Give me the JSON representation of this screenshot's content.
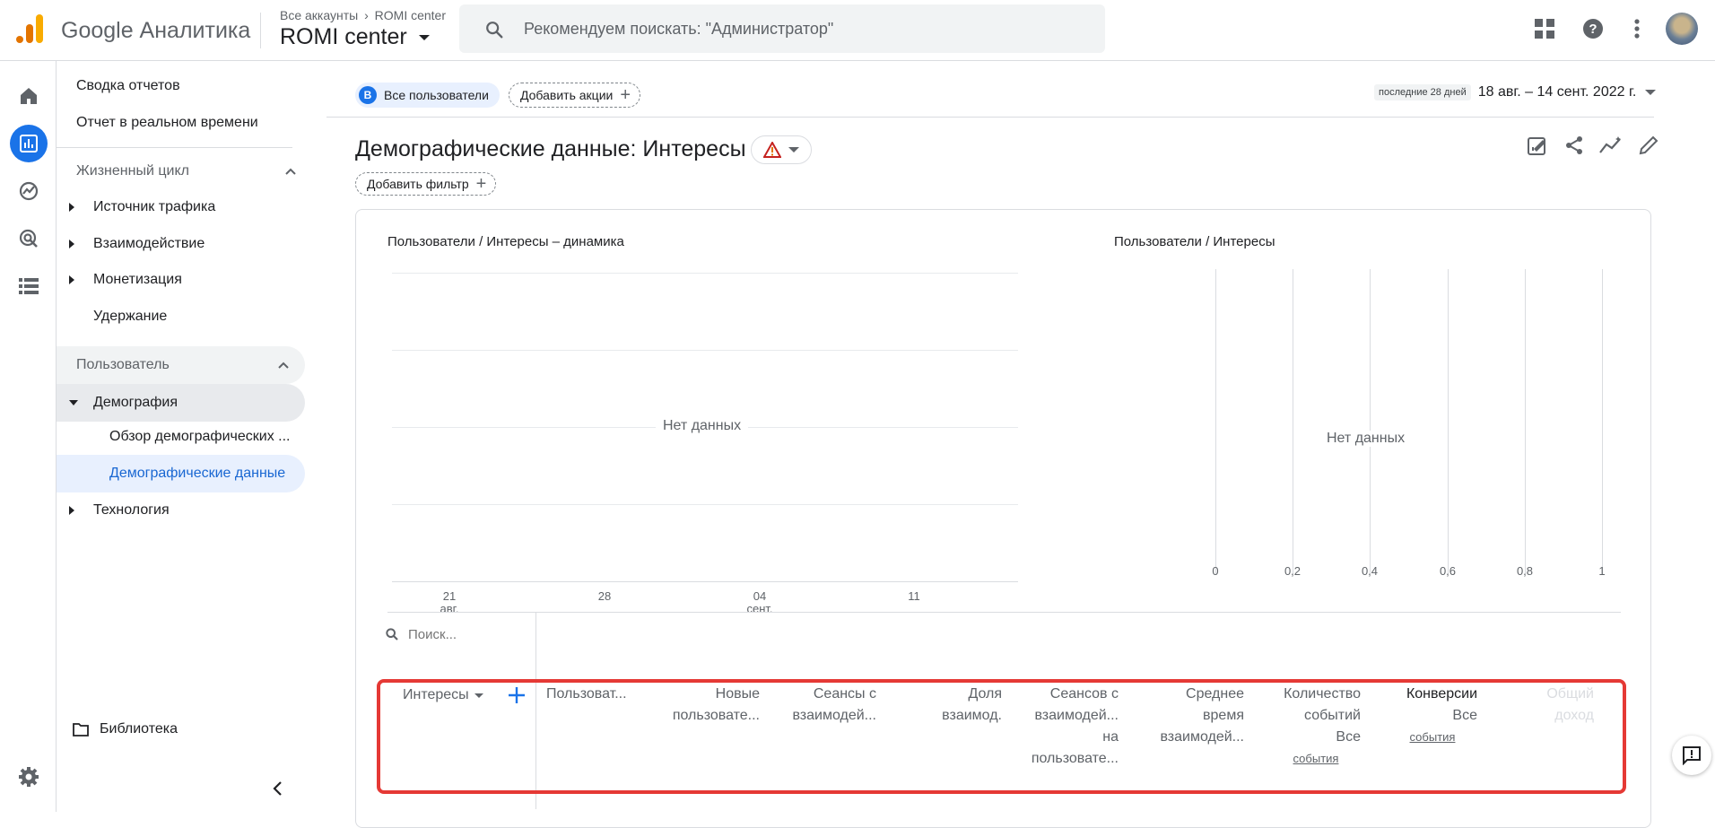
{
  "header": {
    "brand": "Google Аналитика",
    "breadcrumb_root": "Все аккаунты",
    "breadcrumb_leaf": "ROMI center",
    "account_name": "ROMI center",
    "search_placeholder": "Рекомендуем поискать: \"Администратор\""
  },
  "nav": {
    "report_summary": "Сводка отчетов",
    "realtime": "Отчет в реальном времени",
    "lifecycle_section": "Жизненный цикл",
    "lifecycle_items": [
      "Источник трафика",
      "Взаимодействие",
      "Монетизация",
      "Удержание"
    ],
    "user_section": "Пользователь",
    "demography": "Демография",
    "demo_overview": "Обзор демографических ...",
    "demo_details": "Демографические данные",
    "technology": "Технология",
    "library": "Библиотека"
  },
  "toolbar": {
    "segment_badge": "В",
    "segment_label": "Все пользователи",
    "add_comparison": "Добавить акции",
    "date_prefix": "последние 28 дней",
    "date_range": "18 авг. – 14 сент. 2022 г."
  },
  "page": {
    "title": "Демографические данные: Интересы",
    "add_filter": "Добавить фильтр"
  },
  "line_chart": {
    "title": "Пользователи / Интересы – динамика",
    "no_data": "Нет данных",
    "x_ticks": [
      {
        "day": "21",
        "month": "авг."
      },
      {
        "day": "28",
        "month": ""
      },
      {
        "day": "04",
        "month": "сент."
      },
      {
        "day": "11",
        "month": ""
      }
    ]
  },
  "bar_chart": {
    "title": "Пользователи / Интересы",
    "no_data": "Нет данных",
    "x_ticks": [
      "0",
      "0,2",
      "0,4",
      "0,6",
      "0,8",
      "1"
    ]
  },
  "table": {
    "search_placeholder": "Поиск...",
    "dimension": "Интересы",
    "columns": [
      {
        "lines": [
          "Пользоват..."
        ],
        "sub": ""
      },
      {
        "lines": [
          "Новые",
          "пользовате..."
        ],
        "sub": ""
      },
      {
        "lines": [
          "Сеансы с",
          "взаимодей..."
        ],
        "sub": ""
      },
      {
        "lines": [
          "Доля",
          "взаимод."
        ],
        "sub": ""
      },
      {
        "lines": [
          "Сеансов с",
          "взаимодей...",
          "на",
          "пользовате..."
        ],
        "sub": ""
      },
      {
        "lines": [
          "Среднее",
          "время",
          "взаимодей..."
        ],
        "sub": ""
      },
      {
        "lines": [
          "Количество",
          "событий",
          "Все"
        ],
        "sub": "события"
      },
      {
        "lines": [
          "Конверсии",
          "Все"
        ],
        "sub": "события"
      },
      {
        "lines": [
          "Общий",
          "доход"
        ],
        "sub": ""
      }
    ]
  }
}
